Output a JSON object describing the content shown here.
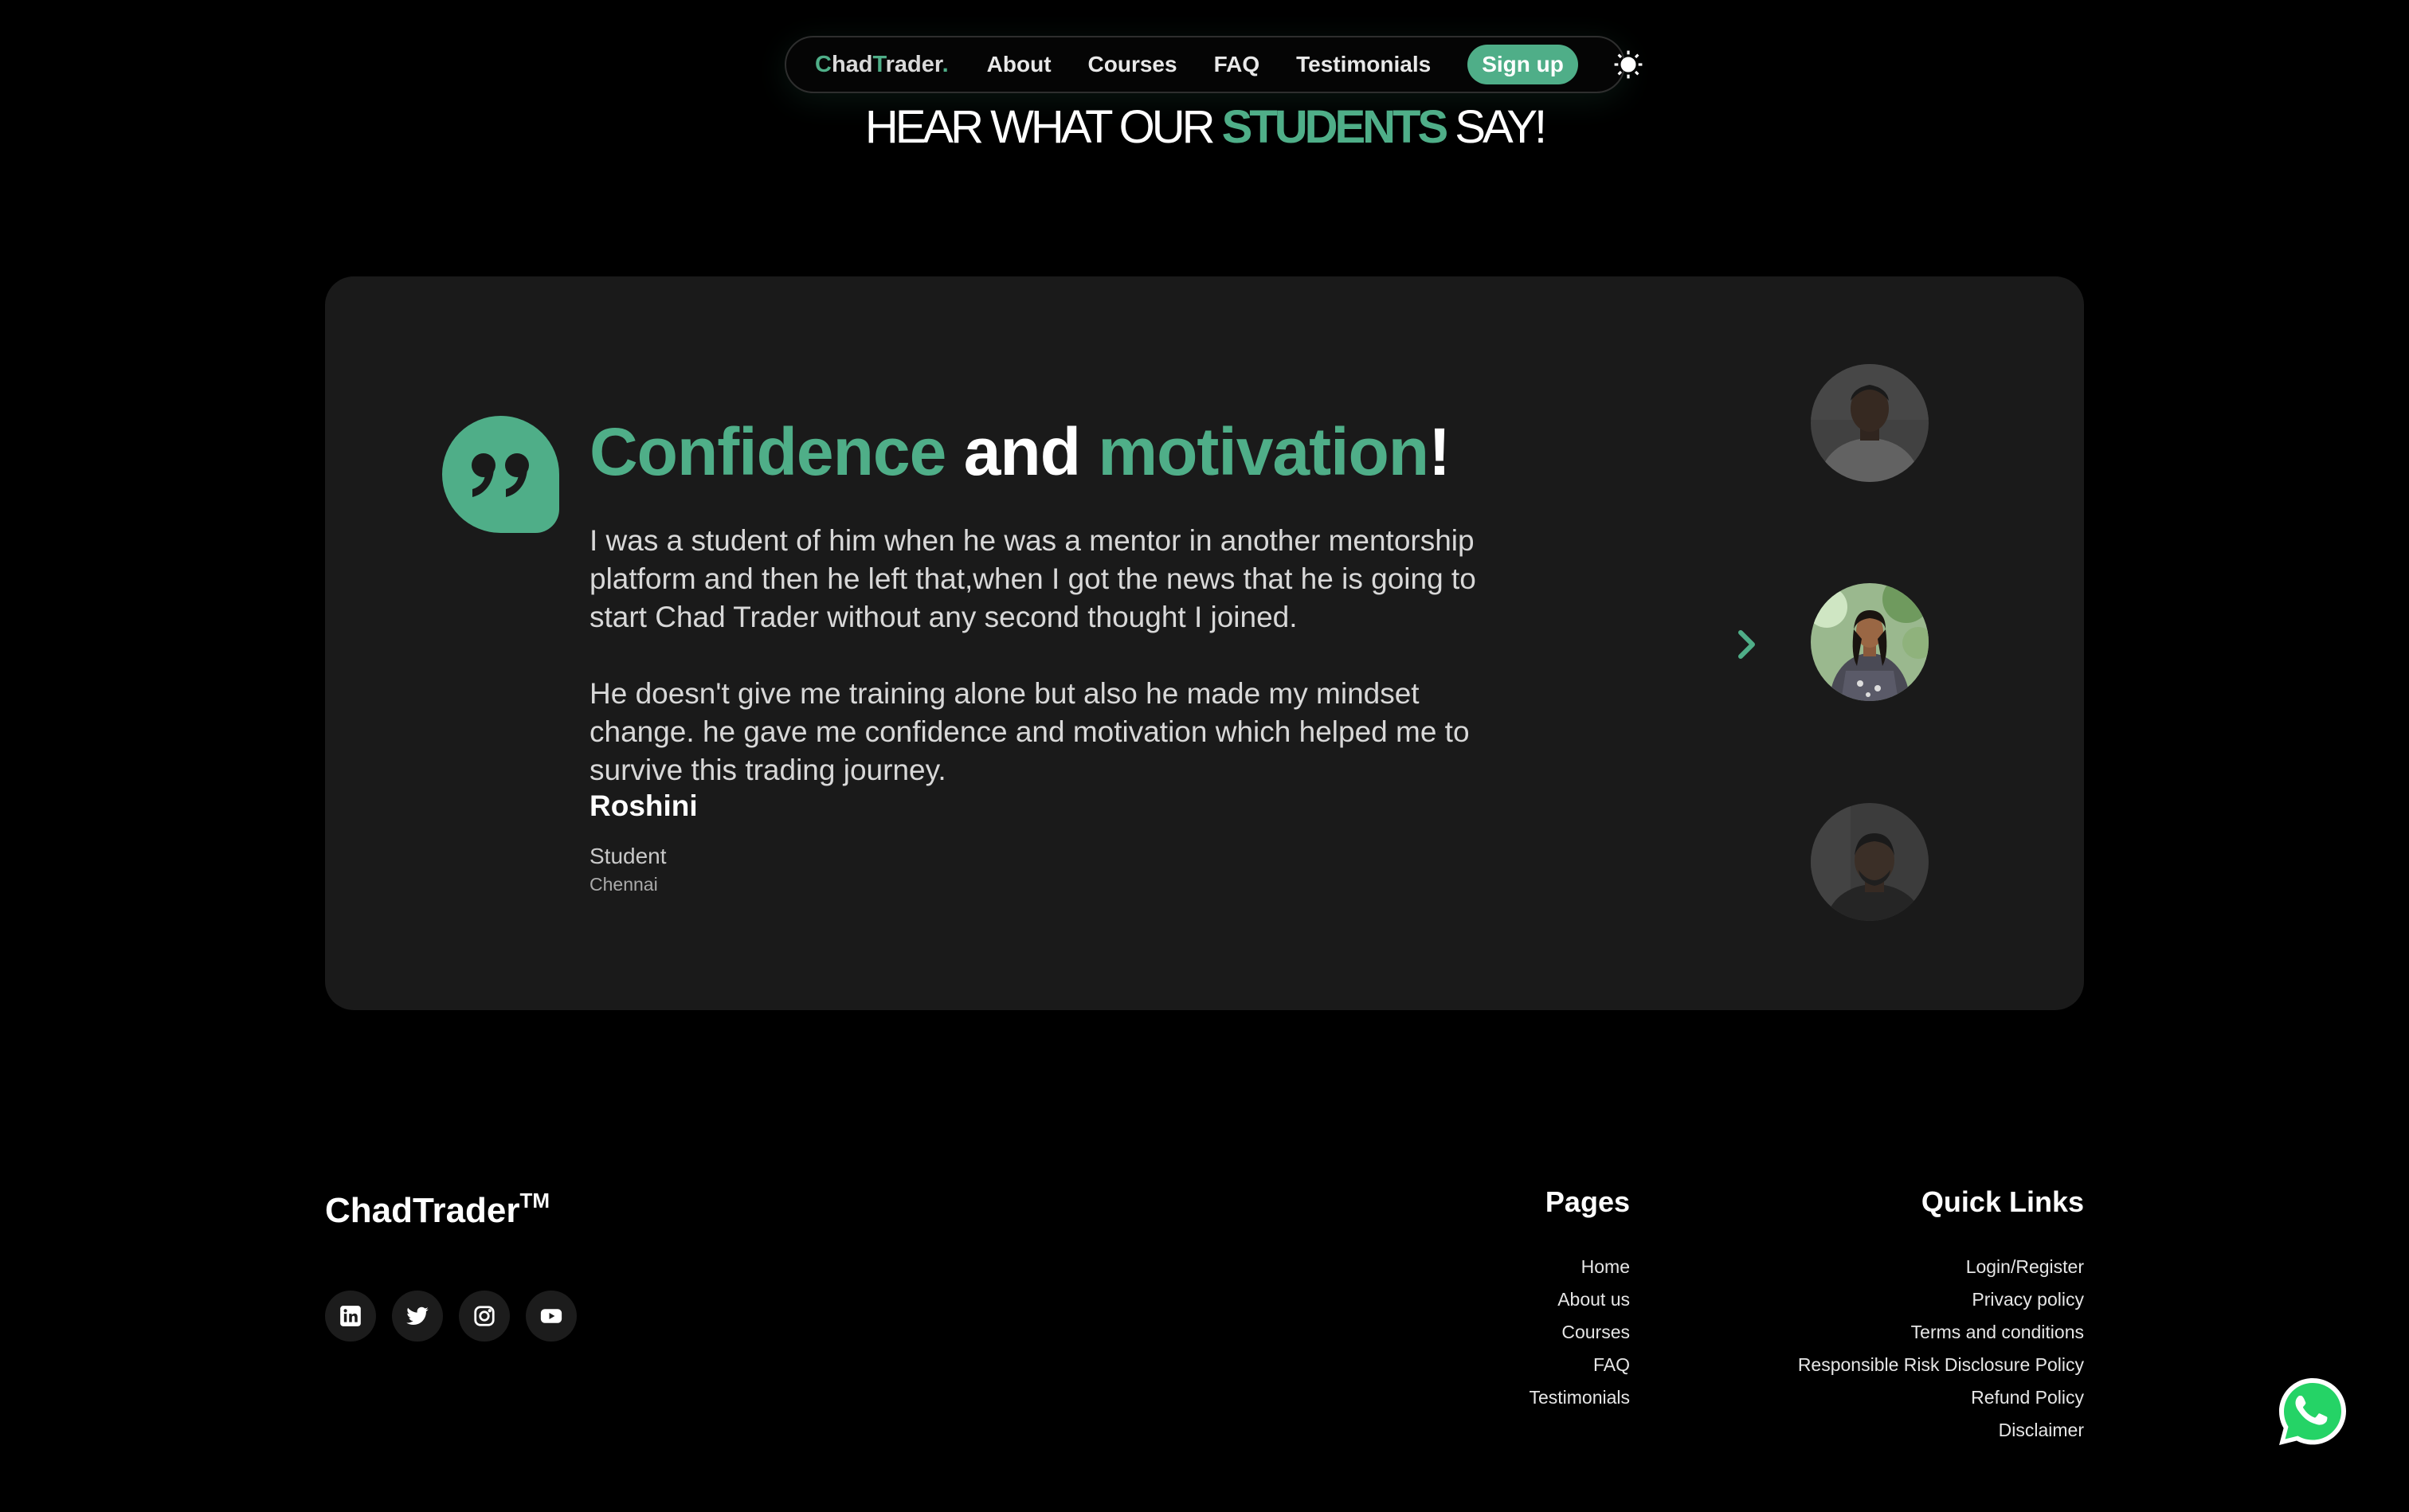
{
  "nav": {
    "logo_part1_accent": "C",
    "logo_part1": "had",
    "logo_part2_accent": "T",
    "logo_part2": "rader",
    "logo_dot": ".",
    "links": [
      "About",
      "Courses",
      "FAQ",
      "Testimonials"
    ],
    "signup_label": "Sign up",
    "theme_icon": "sun-icon"
  },
  "heading": {
    "before": "HEAR WHAT OUR ",
    "accent": "STUDENTS",
    "after": " SAY!"
  },
  "testimonial": {
    "title_word1": "Confidence",
    "title_mid": " and ",
    "title_word2": "motivation",
    "title_end": "!",
    "paragraph1": "I was a student of him when he was a mentor in another mentorship\nplatform and then he left that,when I got the news that he is going to\nstart Chad Trader without any second thought I joined.",
    "paragraph2": "He doesn't give me training alone but also he made my mindset\nchange. he gave me confidence and motivation which helped me to\nsurvive this trading journey.",
    "author": "Roshini",
    "role": "Student",
    "city": "Chennai",
    "next_icon": "chevron-right-icon"
  },
  "footer": {
    "brand": "ChadTrader",
    "brand_tm": "TM",
    "socials": [
      "linkedin-icon",
      "twitter-icon",
      "instagram-icon",
      "youtube-icon"
    ],
    "pages_title": "Pages",
    "pages": [
      "Home",
      "About us",
      "Courses",
      "FAQ",
      "Testimonials"
    ],
    "quick_links_title": "Quick Links",
    "quick_links": [
      "Login/Register",
      "Privacy policy",
      "Terms and conditions",
      "Responsible Risk Disclosure Policy",
      "Refund Policy",
      "Disclaimer"
    ]
  },
  "colors": {
    "accent": "#4fae88",
    "card_bg": "#1a1a1a",
    "page_bg": "#000000",
    "whatsapp": "#25d366"
  }
}
